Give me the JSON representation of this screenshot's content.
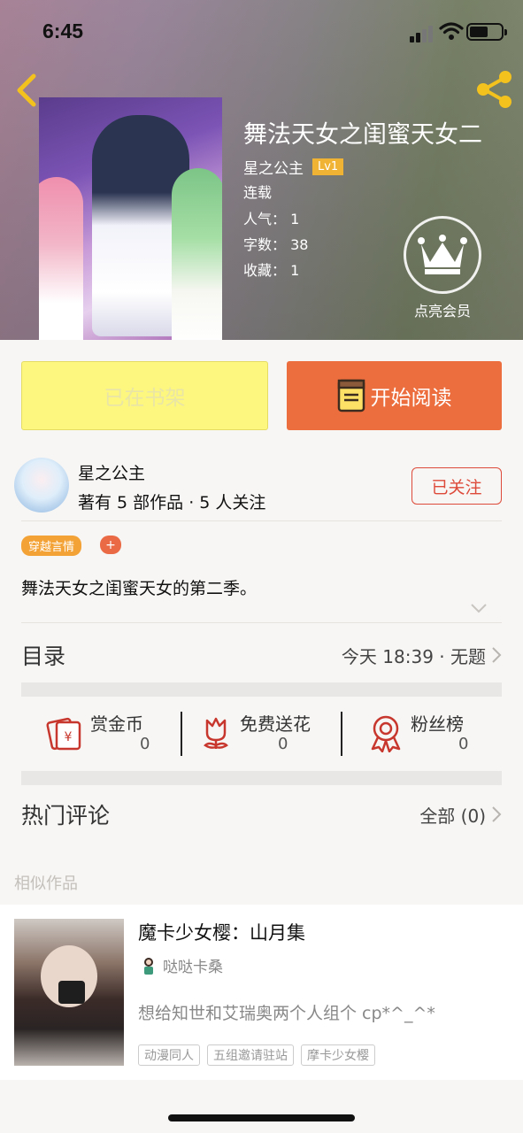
{
  "status_bar": {
    "time": "6:45"
  },
  "header": {
    "book_title": "舞法天女之闺蜜天女二",
    "author": "星之公主",
    "author_level": "Lv1",
    "status": "连载",
    "popularity": "人气：  1",
    "word_count": "字数：  38",
    "favorites": "收藏：  1",
    "vip_label": "点亮会员"
  },
  "actions": {
    "shelf_label": "已在书架",
    "read_label": "开始阅读"
  },
  "author_card": {
    "name": "星之公主",
    "stats": "著有 5 部作品 · 5 人关注",
    "follow_label": "已关注"
  },
  "tags": {
    "items": [
      "穿越言情"
    ],
    "add": "+"
  },
  "description": "舞法天女之闺蜜天女的第二季。",
  "toc": {
    "label": "目录",
    "latest": "今天 18:39 · 无题"
  },
  "rewards": [
    {
      "label": "赏金币",
      "value": "0",
      "icon": "coin-envelope-icon"
    },
    {
      "label": "免费送花",
      "value": "0",
      "icon": "flower-icon"
    },
    {
      "label": "粉丝榜",
      "value": "0",
      "icon": "medal-icon"
    }
  ],
  "comments": {
    "label": "热门评论",
    "all": "全部 (0)"
  },
  "similar": {
    "heading": "相似作品",
    "items": [
      {
        "title": "魔卡少女樱：山月集",
        "author": "哒哒卡桑",
        "desc": "想给知世和艾瑞奥两个人组个 cp*^_^*",
        "tags": [
          "动漫同人",
          "五组邀请驻站",
          "摩卡少女樱"
        ]
      }
    ]
  },
  "colors": {
    "accent": "#ec6d3d",
    "follow_red": "#dd4a3a",
    "shelf_yellow": "#fdf77f",
    "tag_orange": "#f3a236",
    "level_gold": "#f1b333"
  }
}
